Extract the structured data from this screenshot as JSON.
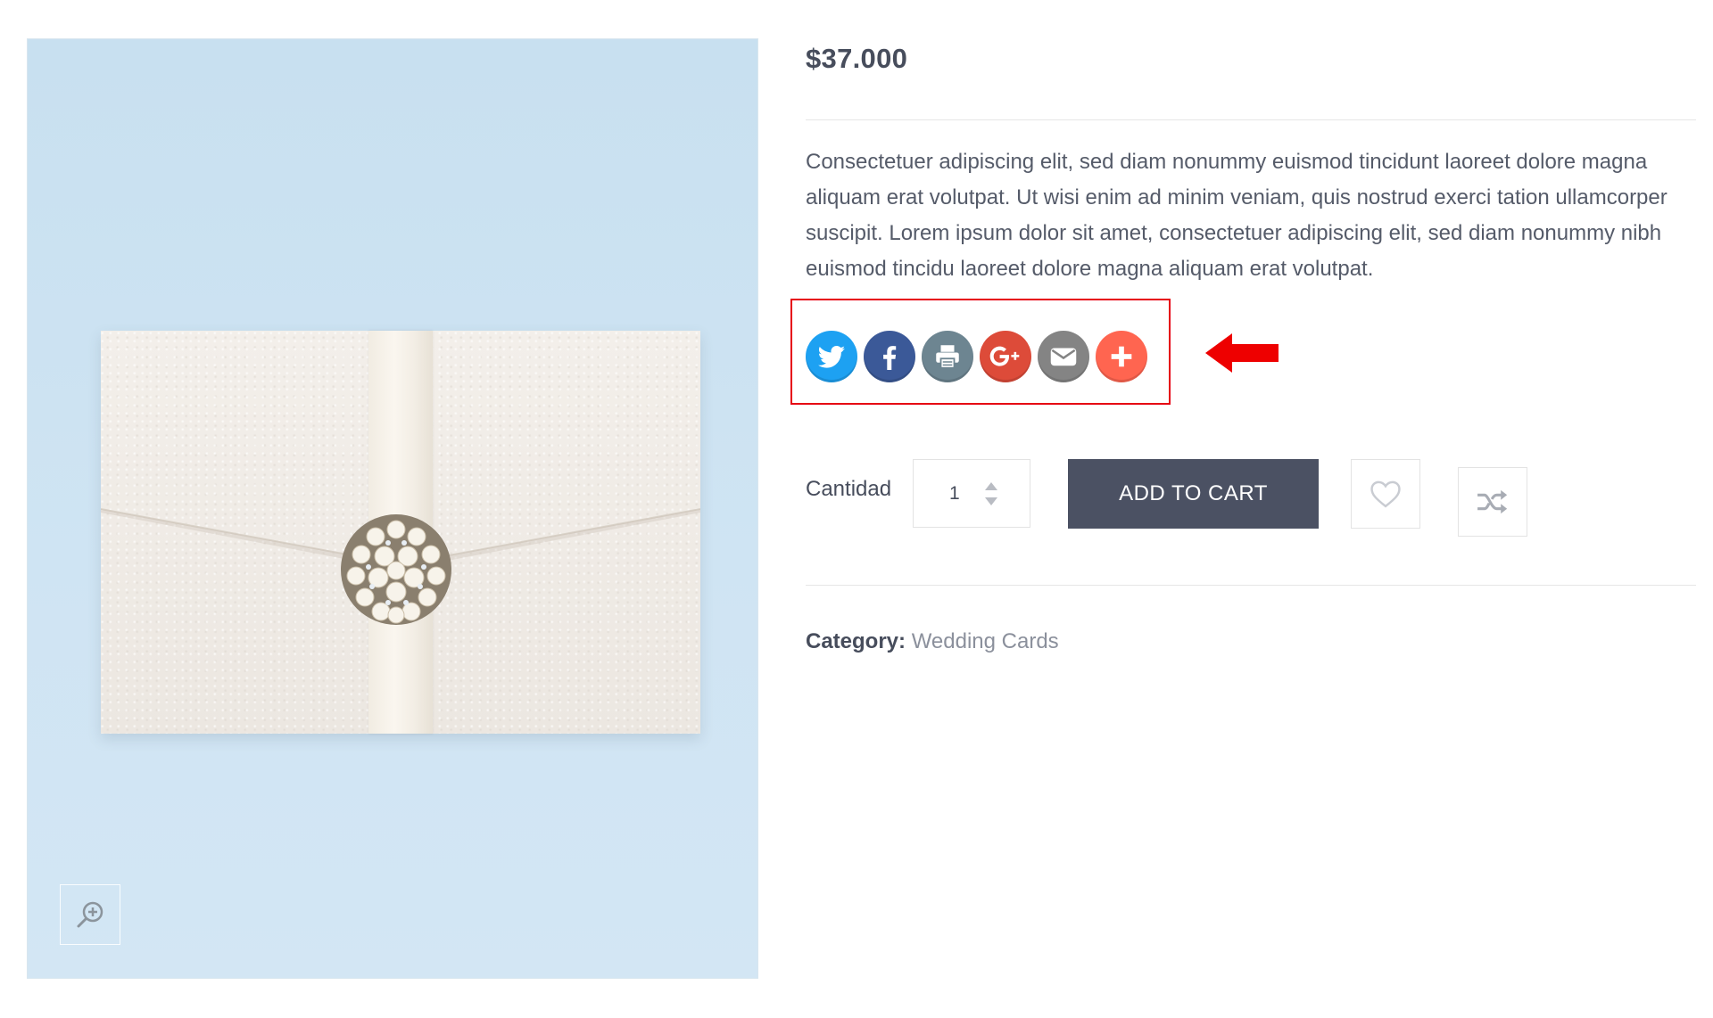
{
  "product": {
    "price": "$37.000",
    "description": "Consectetuer adipiscing elit, sed diam nonummy euismod tincidunt laoreet dolore magna aliquam erat volutpat. Ut wisi enim ad minim veniam, quis nostrud exerci tation ullamcorper suscipit. Lorem ipsum dolor sit amet, consectetuer adipiscing elit, sed diam nonummy nibh euismod tincidu laoreet dolore magna aliquam erat volutpat."
  },
  "gallery": {
    "zoom_icon": "zoom-in-icon"
  },
  "share": {
    "items": [
      {
        "name": "twitter",
        "icon": "twitter-icon",
        "color": "#1da1f2"
      },
      {
        "name": "facebook",
        "icon": "facebook-icon",
        "color": "#3b5998"
      },
      {
        "name": "print",
        "icon": "printer-icon",
        "color": "#6d8591"
      },
      {
        "name": "google-plus",
        "icon": "google-plus-icon",
        "color": "#dd4b39"
      },
      {
        "name": "email",
        "icon": "envelope-icon",
        "color": "#848484"
      },
      {
        "name": "more",
        "icon": "plus-icon",
        "color": "#ff6550"
      }
    ],
    "highlight_color": "#e60012"
  },
  "cart": {
    "quantity_label": "Cantidad",
    "quantity_value": "1",
    "add_to_cart_label": "ADD TO CART",
    "button_color": "#4b5163",
    "wishlist_icon": "heart-icon",
    "compare_icon": "shuffle-icon"
  },
  "meta": {
    "category_label": "Category:",
    "category_value": "Wedding Cards"
  }
}
